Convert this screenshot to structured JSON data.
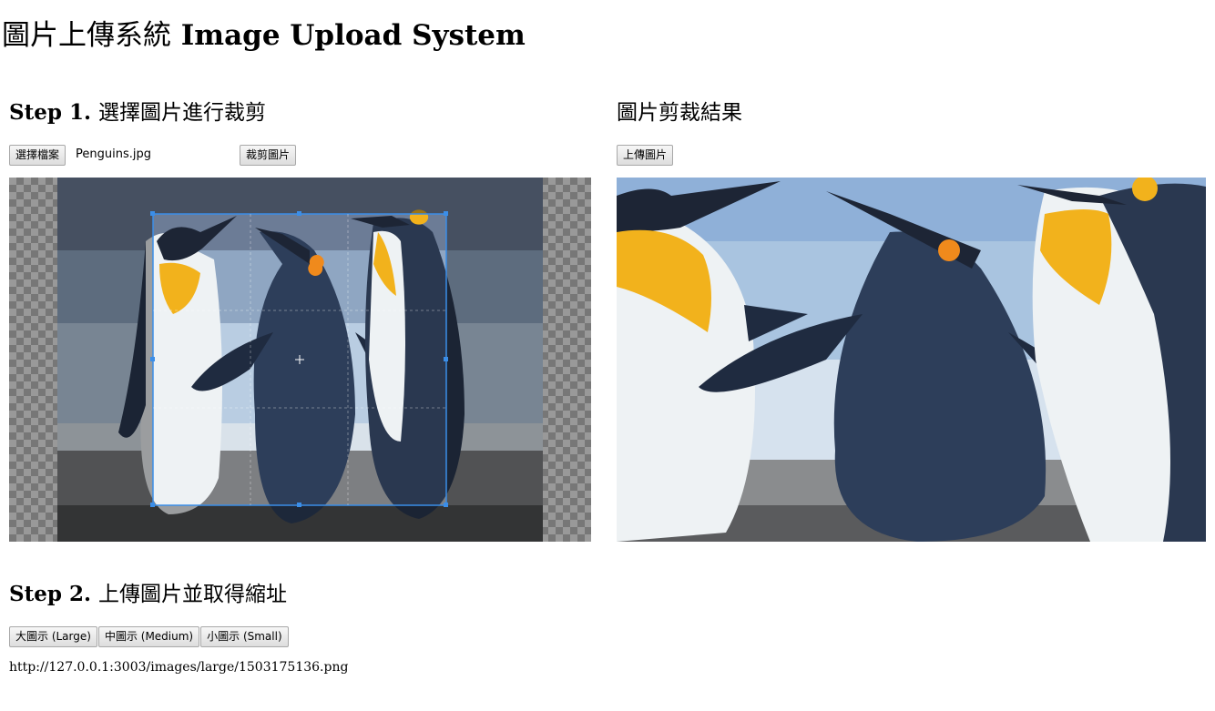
{
  "page": {
    "title_cjk": "圖片上傳系統",
    "title_en": "Image Upload System"
  },
  "step1": {
    "label": "Step 1.",
    "text": "選擇圖片進行裁剪",
    "choose_file_label": "選擇檔案",
    "file_name": "Penguins.jpg",
    "crop_button_label": "裁剪圖片"
  },
  "result": {
    "heading": "圖片剪裁結果",
    "upload_button_label": "上傳圖片"
  },
  "step2": {
    "label": "Step 2.",
    "text": "上傳圖片並取得縮址",
    "size_buttons": [
      {
        "label": "大圖示 (Large)"
      },
      {
        "label": "中圖示 (Medium)"
      },
      {
        "label": "小圖示 (Small)"
      }
    ],
    "url": "http://127.0.0.1:3003/images/large/1503175136.png"
  },
  "colors": {
    "crop_box": "#3b8ee8",
    "sky": "#a9c4e0",
    "penguin_dark": "#2a3850",
    "penguin_yellow": "#f2b21c"
  }
}
